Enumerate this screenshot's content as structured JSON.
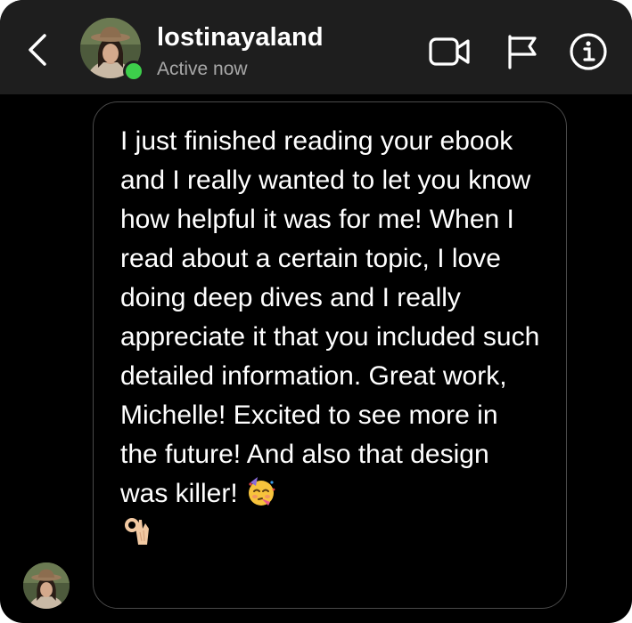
{
  "header": {
    "username": "lostinayaland",
    "status": "Active now",
    "icons": {
      "back": "chevron-left-icon",
      "video": "video-camera-icon",
      "flag": "flag-icon",
      "info": "info-icon"
    }
  },
  "message": {
    "text": "I just finished reading your ebook and I really wanted to let you know how helpful it was for me! When I read about a certain topic, I love doing deep dives and I really appreciate it that you included such detailed information. Great work, Michelle! Excited to see more in the future! And also that design was killer!",
    "emojis": [
      "partying-face-emoji",
      "ok-hand-emoji"
    ]
  },
  "colors": {
    "header_bg": "#1e1e1e",
    "page_bg": "#000000",
    "online": "#3dcf4b",
    "status_text": "#a8a8a8",
    "bubble_border": "#4a4a4a"
  }
}
